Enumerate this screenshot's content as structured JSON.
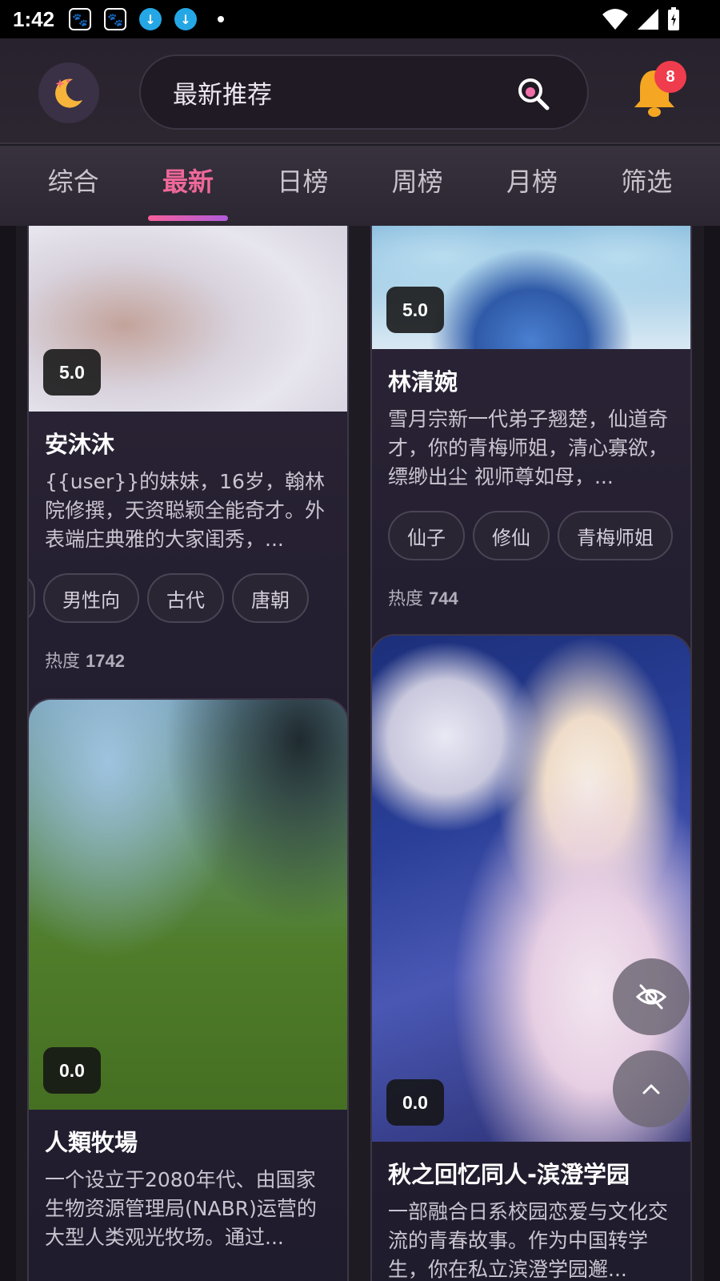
{
  "status_bar": {
    "time": "1:42"
  },
  "header": {
    "search_text": "最新推荐",
    "notification_count": "8"
  },
  "tabs": [
    {
      "label": "综合",
      "active": false
    },
    {
      "label": "最新",
      "active": true
    },
    {
      "label": "日榜",
      "active": false
    },
    {
      "label": "周榜",
      "active": false
    },
    {
      "label": "月榜",
      "active": false
    },
    {
      "label": "筛选",
      "active": false
    }
  ],
  "cards": [
    {
      "rating": "5.0",
      "title": "安沐沐",
      "desc": "{{user}}的妹妹，16岁，翰林院修撰，天资聪颖全能奇才。外表端庄典雅的大家闺秀，...",
      "tags": [
        "男性向",
        "古代",
        "唐朝"
      ],
      "heat_label": "热度",
      "heat_value": "1742"
    },
    {
      "rating": "5.0",
      "title": "林清婉",
      "desc": "雪月宗新一代弟子翘楚，仙道奇才，你的青梅师姐，清心寡欲，缥缈出尘 视师尊如母，...",
      "tags": [
        "仙子",
        "修仙",
        "青梅师姐"
      ],
      "heat_label": "热度",
      "heat_value": "744"
    },
    {
      "rating": "0.0",
      "title": "人類牧場",
      "desc": "一个设立于2080年代、由国家生物资源管理局(NABR)运营的大型人类观光牧场。通过..."
    },
    {
      "rating": "0.0",
      "title": "秋之回忆同人-滨澄学园",
      "desc": "一部融合日系校园恋爱与文化交流的青春故事。作为中国转学生，你在私立滨澄学园邂..."
    }
  ],
  "icons": {
    "moon": "moon-icon",
    "search": "search-icon",
    "bell": "bell-icon",
    "hide": "eye-off-icon",
    "top": "chevron-up-icon"
  },
  "colors": {
    "accent": "#f0689a",
    "badge": "#ef3d4d",
    "bell": "#f5a623"
  }
}
